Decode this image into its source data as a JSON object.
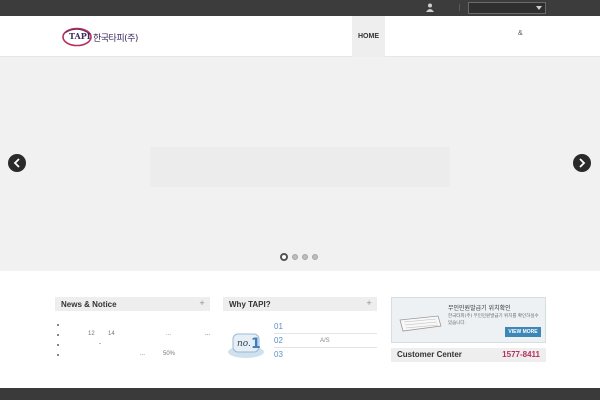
{
  "topbar": {
    "language_select_value": ""
  },
  "header": {
    "logo_mark": "TAPI",
    "logo_text": "한국타피(주)",
    "nav": [
      {
        "label": "HOME"
      },
      {
        "label": "&"
      }
    ]
  },
  "news": {
    "title": "News & Notice",
    "more": "+",
    "rows": [
      {
        "a": "",
        "b": ""
      },
      {
        "a": "12",
        "b": "14",
        "c": "...",
        "d": "..."
      },
      {
        "a": "",
        "b": ""
      },
      {
        "a": "",
        "b": "...",
        "c": "50%"
      }
    ]
  },
  "why": {
    "title": "Why TAPI?",
    "more": "+",
    "items": [
      {
        "num": "01",
        "text": ""
      },
      {
        "num": "02",
        "text": "A/S"
      },
      {
        "num": "03",
        "text": ""
      }
    ]
  },
  "kiosk": {
    "title": "무인민원발급기 위치확인",
    "desc": "한국타피(주) 무인민원발급기 위치를 확인하실수 있습니다.",
    "button": "VIEW MORE"
  },
  "customer_center": {
    "label": "Customer Center",
    "phone": "1577-8411"
  },
  "colors": {
    "accent": "#b5305f",
    "link_blue": "#5a8fc7",
    "button_blue": "#3c87b7"
  }
}
